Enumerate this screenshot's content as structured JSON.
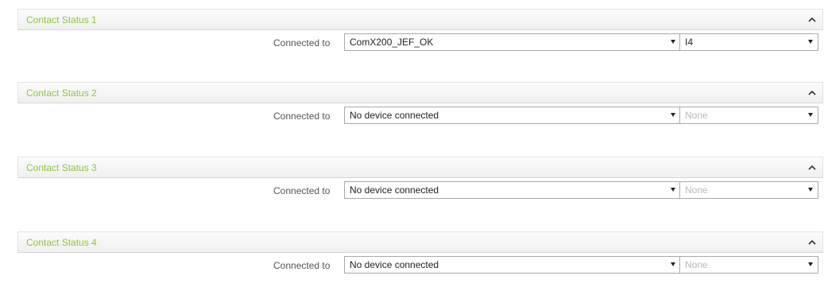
{
  "sections": [
    {
      "title": "Contact Status 1",
      "connected_label": "Connected to",
      "device": "ComX200_JEF_OK",
      "io": "I4",
      "io_disabled": false
    },
    {
      "title": "Contact Status 2",
      "connected_label": "Connected to",
      "device": "No device connected",
      "io": "None",
      "io_disabled": true
    },
    {
      "title": "Contact Status 3",
      "connected_label": "Connected to",
      "device": "No device connected",
      "io": "None",
      "io_disabled": true
    },
    {
      "title": "Contact Status 4",
      "connected_label": "Connected to",
      "device": "No device connected",
      "io": "None",
      "io_disabled": true
    }
  ],
  "icons": {
    "collapse": "chevron-up-icon",
    "dropdown": "dropdown-arrow-icon"
  },
  "colors": {
    "section_title": "#8cc63f",
    "disabled_text": "#b8b8b8"
  }
}
